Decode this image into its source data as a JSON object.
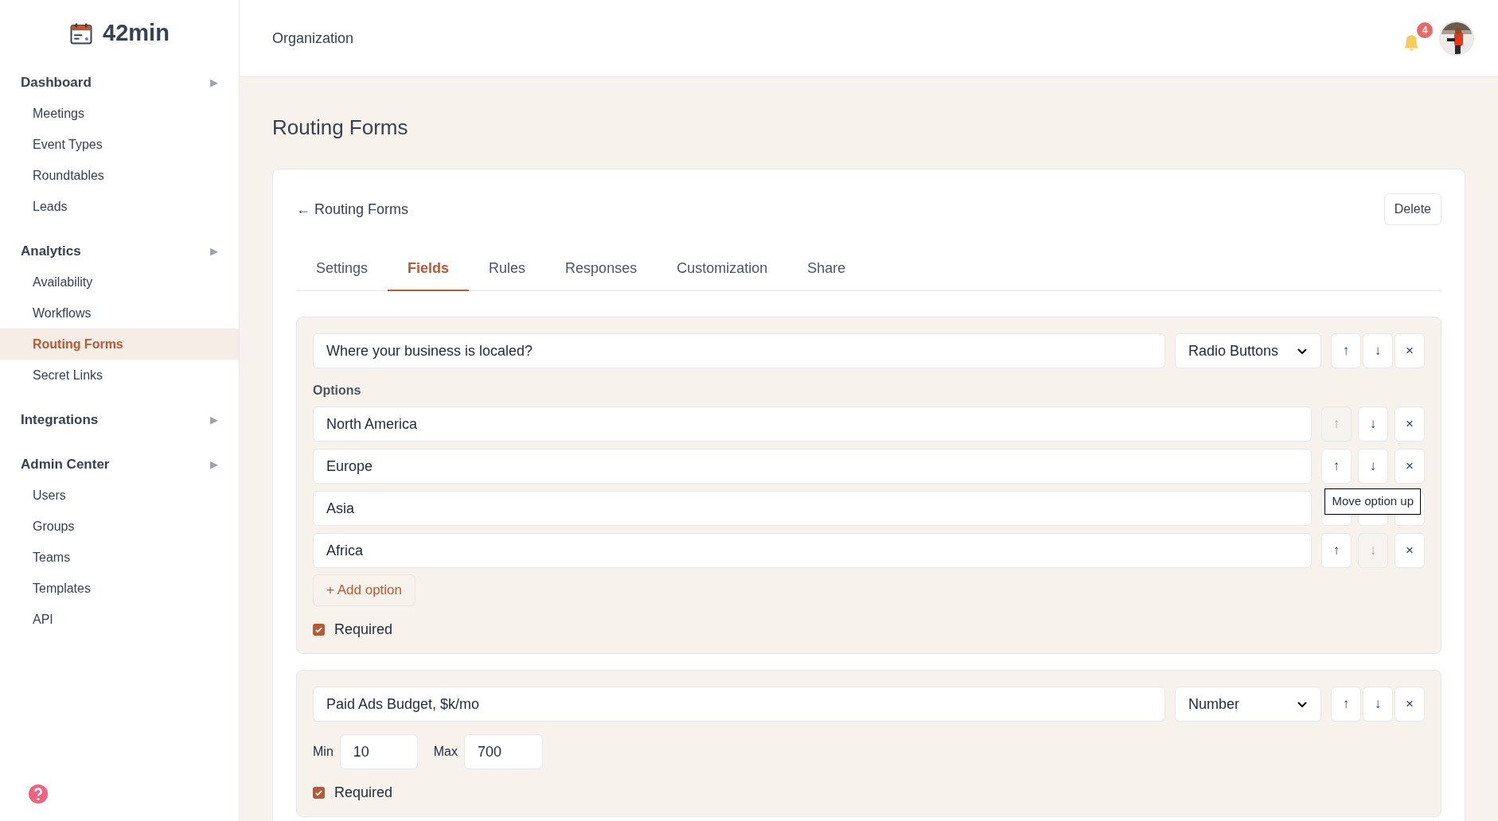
{
  "brand": {
    "name": "42min"
  },
  "sidebar": {
    "groups": [
      {
        "label": "Dashboard",
        "expand_icon": "▶",
        "items": [
          {
            "label": "Meetings",
            "selected": false
          },
          {
            "label": "Event Types",
            "selected": false
          },
          {
            "label": "Roundtables",
            "selected": false
          },
          {
            "label": "Leads",
            "selected": false
          }
        ]
      },
      {
        "label": "Analytics",
        "expand_icon": "▶",
        "items": [
          {
            "label": "Availability",
            "selected": false
          },
          {
            "label": "Workflows",
            "selected": false
          },
          {
            "label": "Routing Forms",
            "selected": true
          },
          {
            "label": "Secret Links",
            "selected": false
          }
        ]
      },
      {
        "label": "Integrations",
        "expand_icon": "▶"
      },
      {
        "label": "Admin Center",
        "expand_icon": "▶",
        "items": [
          {
            "label": "Users",
            "selected": false
          },
          {
            "label": "Groups",
            "selected": false
          },
          {
            "label": "Teams",
            "selected": false
          },
          {
            "label": "Templates",
            "selected": false
          },
          {
            "label": "API",
            "selected": false
          }
        ]
      }
    ]
  },
  "header": {
    "title": "Organization",
    "notification_count": "4"
  },
  "page": {
    "title": "Routing Forms",
    "back_link": "← Routing Forms",
    "delete_button": "Delete",
    "tabs": [
      {
        "label": "Settings",
        "selected": false
      },
      {
        "label": "Fields",
        "selected": true
      },
      {
        "label": "Rules",
        "selected": false
      },
      {
        "label": "Responses",
        "selected": false
      },
      {
        "label": "Customization",
        "selected": false
      },
      {
        "label": "Share",
        "selected": false
      }
    ],
    "fields": [
      {
        "kind": "radio",
        "question": "Where your business is localed?",
        "type": "Radio Buttons",
        "move_up": "↑",
        "move_down": "↓",
        "remove": "×",
        "options_label": "Options",
        "options": [
          {
            "value": "North America",
            "up": "↑",
            "up_disabled": true,
            "down": "↓",
            "down_disabled": false,
            "remove": "×"
          },
          {
            "value": "Europe",
            "up": "↑",
            "up_disabled": false,
            "down": "↓",
            "down_disabled": false,
            "remove": "×"
          },
          {
            "value": "Asia",
            "up_disabled": false,
            "down_disabled": false
          },
          {
            "value": "Africa",
            "up": "↑",
            "up_disabled": false,
            "down": "↓",
            "down_disabled": true,
            "remove": "×"
          }
        ],
        "add_option": "+ Add option",
        "required_label": "Required",
        "required": true
      },
      {
        "kind": "number",
        "question": "Paid Ads Budget, $k/mo",
        "type": "Number",
        "move_up": "↑",
        "move_down": "↓",
        "remove": "×",
        "min_label": "Min",
        "min": "10",
        "max_label": "Max",
        "max": "700",
        "required_label": "Required",
        "required": true
      }
    ]
  },
  "tooltip": {
    "text": "Move option up"
  }
}
